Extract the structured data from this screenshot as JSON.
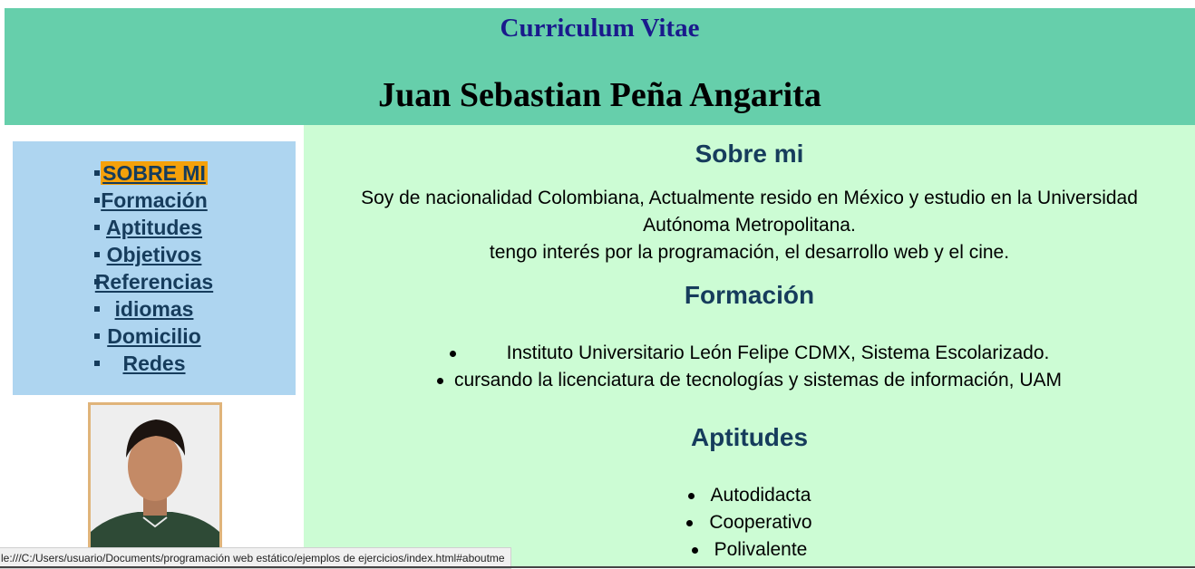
{
  "header": {
    "title": "Curriculum Vitae",
    "name": "Juan Sebastian Peña Angarita"
  },
  "nav": {
    "items": [
      {
        "label": "SOBRE MI",
        "active": true
      },
      {
        "label": "Formación"
      },
      {
        "label": "Aptitudes"
      },
      {
        "label": "Objetivos"
      },
      {
        "label": "Referencias"
      },
      {
        "label": "idiomas"
      },
      {
        "label": "Domicilio"
      },
      {
        "label": "Redes"
      }
    ]
  },
  "about": {
    "title": "Sobre mi",
    "line1": "Soy de nacionalidad Colombiana, Actualmente resido en México y estudio en la Universidad",
    "line2": "Autónoma Metropolitana.",
    "line3": "tengo interés por la programación, el desarrollo web y el cine."
  },
  "education": {
    "title": "Formación",
    "items": [
      "Instituto Universitario León Felipe CDMX, Sistema Escolarizado.",
      "cursando la licenciatura de tecnologías y sistemas de información, UAM"
    ]
  },
  "skills": {
    "title": "Aptitudes",
    "items": [
      "Autodidacta",
      "Cooperativo",
      "Polivalente"
    ]
  },
  "status_bar": {
    "url": "le:///C:/Users/usuario/Documents/programación web estático/ejemplos de ejercicios/index.html#aboutme"
  },
  "colors": {
    "header_bg": "#66cfab",
    "sidebar_bg": "#aed5f0",
    "main_bg": "#ccfcd4",
    "active_highlight": "#f5a10a",
    "link_color": "#163c5c"
  }
}
